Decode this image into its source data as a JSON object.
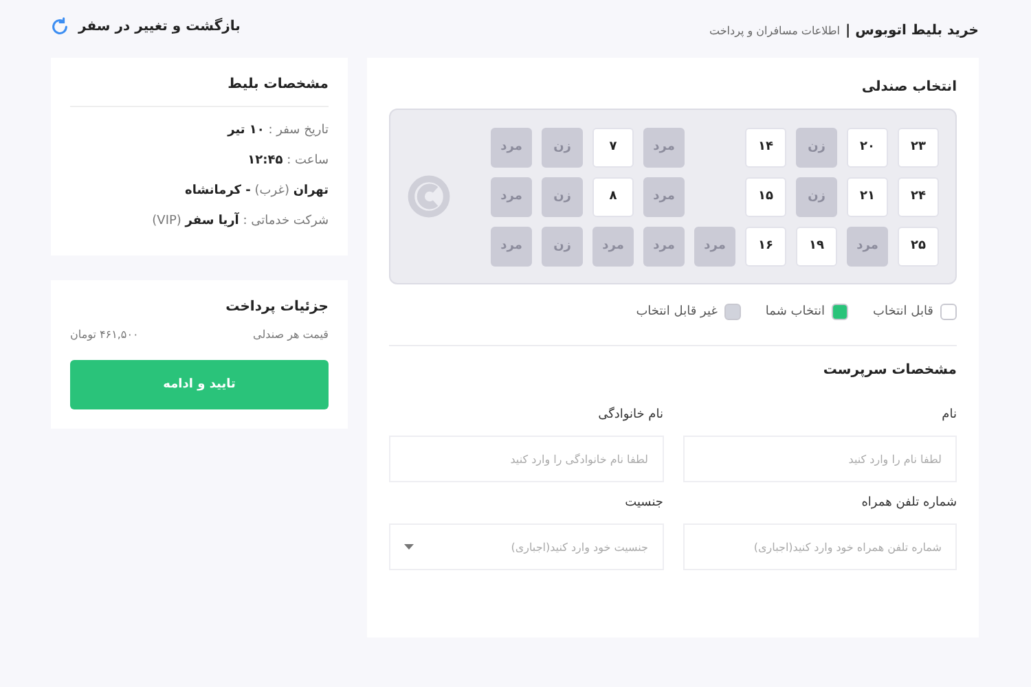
{
  "header": {
    "title": "خرید بلیط اتوبوس |",
    "subtitle": "اطلاعات مسافران و پرداخت",
    "back_link": "بازگشت و تغییر در سفر"
  },
  "seat_selection": {
    "title": "انتخاب صندلی",
    "columns": [
      {
        "cells": [
          {
            "kind": "free",
            "label": "۲۳"
          },
          {
            "kind": "free",
            "label": "۲۴"
          },
          {
            "kind": "free",
            "label": "۲۵"
          }
        ]
      },
      {
        "cells": [
          {
            "kind": "free",
            "label": "۲۰"
          },
          {
            "kind": "free",
            "label": "۲۱"
          },
          {
            "kind": "taken",
            "label": "مرد"
          }
        ]
      },
      {
        "cells": [
          {
            "kind": "taken",
            "label": "زن"
          },
          {
            "kind": "taken",
            "label": "زن"
          },
          {
            "kind": "free",
            "label": "۱۹"
          }
        ]
      },
      {
        "cells": [
          {
            "kind": "free",
            "label": "۱۴"
          },
          {
            "kind": "free",
            "label": "۱۵"
          },
          {
            "kind": "free",
            "label": "۱۶"
          }
        ]
      },
      {
        "cells": [
          {
            "kind": "gap"
          },
          {
            "kind": "gap"
          },
          {
            "kind": "taken",
            "label": "مرد"
          }
        ]
      },
      {
        "cells": [
          {
            "kind": "taken",
            "label": "مرد"
          },
          {
            "kind": "taken",
            "label": "مرد"
          },
          {
            "kind": "taken",
            "label": "مرد"
          }
        ]
      },
      {
        "cells": [
          {
            "kind": "free",
            "label": "۷"
          },
          {
            "kind": "free",
            "label": "۸"
          },
          {
            "kind": "taken",
            "label": "مرد"
          }
        ]
      },
      {
        "cells": [
          {
            "kind": "taken",
            "label": "زن"
          },
          {
            "kind": "taken",
            "label": "زن"
          },
          {
            "kind": "taken",
            "label": "زن"
          }
        ]
      },
      {
        "cells": [
          {
            "kind": "taken",
            "label": "مرد"
          },
          {
            "kind": "taken",
            "label": "مرد"
          },
          {
            "kind": "taken",
            "label": "مرد"
          }
        ]
      }
    ],
    "legend": [
      {
        "label": "قابل انتخاب",
        "color": "#ffffff"
      },
      {
        "label": "انتخاب شما",
        "color": "#2ac37a"
      },
      {
        "label": "غیر قابل انتخاب",
        "color": "#d1d3dc"
      }
    ]
  },
  "guardian": {
    "title": "مشخصات سرپرست",
    "fields": [
      {
        "kind": "text",
        "label": "نام",
        "placeholder": "لطفا نام را وارد کنید"
      },
      {
        "kind": "text",
        "label": "نام خانوادگی",
        "placeholder": "لطفا نام خانوادگی را وارد کنید"
      },
      {
        "kind": "text",
        "label": "شماره تلفن همراه",
        "placeholder": "شماره تلفن همراه خود وارد کنید(اجباری)"
      },
      {
        "kind": "select",
        "label": "جنسیت",
        "placeholder": "جنسیت خود وارد کنید(اجباری)"
      }
    ]
  },
  "ticket": {
    "title": "مشخصات بلیط",
    "rows": [
      "تاریخ سفر : **۱۰ تیر**",
      "ساعت : **۱۲:۴۵**",
      "**تهران** (غرب) **- کرمانشاه**",
      "شرکت خدماتی : **آریا سفر** (VIP)"
    ]
  },
  "payment": {
    "title": "جزئیات پرداخت",
    "price_label": "قیمت هر صندلی",
    "price": "۴۶۱,۵۰۰ تومان",
    "button": "تایید و ادامه"
  }
}
